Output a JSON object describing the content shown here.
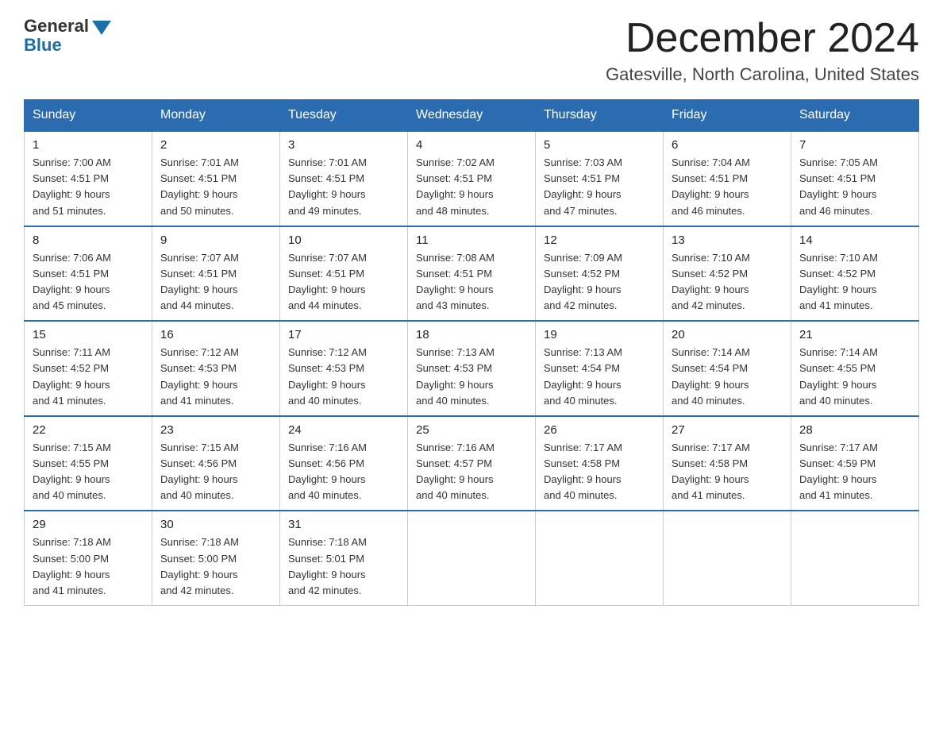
{
  "header": {
    "logo_general": "General",
    "logo_blue": "Blue",
    "month_title": "December 2024",
    "location": "Gatesville, North Carolina, United States"
  },
  "days_of_week": [
    "Sunday",
    "Monday",
    "Tuesday",
    "Wednesday",
    "Thursday",
    "Friday",
    "Saturday"
  ],
  "weeks": [
    [
      {
        "day": "1",
        "sunrise": "7:00 AM",
        "sunset": "4:51 PM",
        "daylight": "9 hours and 51 minutes."
      },
      {
        "day": "2",
        "sunrise": "7:01 AM",
        "sunset": "4:51 PM",
        "daylight": "9 hours and 50 minutes."
      },
      {
        "day": "3",
        "sunrise": "7:01 AM",
        "sunset": "4:51 PM",
        "daylight": "9 hours and 49 minutes."
      },
      {
        "day": "4",
        "sunrise": "7:02 AM",
        "sunset": "4:51 PM",
        "daylight": "9 hours and 48 minutes."
      },
      {
        "day": "5",
        "sunrise": "7:03 AM",
        "sunset": "4:51 PM",
        "daylight": "9 hours and 47 minutes."
      },
      {
        "day": "6",
        "sunrise": "7:04 AM",
        "sunset": "4:51 PM",
        "daylight": "9 hours and 46 minutes."
      },
      {
        "day": "7",
        "sunrise": "7:05 AM",
        "sunset": "4:51 PM",
        "daylight": "9 hours and 46 minutes."
      }
    ],
    [
      {
        "day": "8",
        "sunrise": "7:06 AM",
        "sunset": "4:51 PM",
        "daylight": "9 hours and 45 minutes."
      },
      {
        "day": "9",
        "sunrise": "7:07 AM",
        "sunset": "4:51 PM",
        "daylight": "9 hours and 44 minutes."
      },
      {
        "day": "10",
        "sunrise": "7:07 AM",
        "sunset": "4:51 PM",
        "daylight": "9 hours and 44 minutes."
      },
      {
        "day": "11",
        "sunrise": "7:08 AM",
        "sunset": "4:51 PM",
        "daylight": "9 hours and 43 minutes."
      },
      {
        "day": "12",
        "sunrise": "7:09 AM",
        "sunset": "4:52 PM",
        "daylight": "9 hours and 42 minutes."
      },
      {
        "day": "13",
        "sunrise": "7:10 AM",
        "sunset": "4:52 PM",
        "daylight": "9 hours and 42 minutes."
      },
      {
        "day": "14",
        "sunrise": "7:10 AM",
        "sunset": "4:52 PM",
        "daylight": "9 hours and 41 minutes."
      }
    ],
    [
      {
        "day": "15",
        "sunrise": "7:11 AM",
        "sunset": "4:52 PM",
        "daylight": "9 hours and 41 minutes."
      },
      {
        "day": "16",
        "sunrise": "7:12 AM",
        "sunset": "4:53 PM",
        "daylight": "9 hours and 41 minutes."
      },
      {
        "day": "17",
        "sunrise": "7:12 AM",
        "sunset": "4:53 PM",
        "daylight": "9 hours and 40 minutes."
      },
      {
        "day": "18",
        "sunrise": "7:13 AM",
        "sunset": "4:53 PM",
        "daylight": "9 hours and 40 minutes."
      },
      {
        "day": "19",
        "sunrise": "7:13 AM",
        "sunset": "4:54 PM",
        "daylight": "9 hours and 40 minutes."
      },
      {
        "day": "20",
        "sunrise": "7:14 AM",
        "sunset": "4:54 PM",
        "daylight": "9 hours and 40 minutes."
      },
      {
        "day": "21",
        "sunrise": "7:14 AM",
        "sunset": "4:55 PM",
        "daylight": "9 hours and 40 minutes."
      }
    ],
    [
      {
        "day": "22",
        "sunrise": "7:15 AM",
        "sunset": "4:55 PM",
        "daylight": "9 hours and 40 minutes."
      },
      {
        "day": "23",
        "sunrise": "7:15 AM",
        "sunset": "4:56 PM",
        "daylight": "9 hours and 40 minutes."
      },
      {
        "day": "24",
        "sunrise": "7:16 AM",
        "sunset": "4:56 PM",
        "daylight": "9 hours and 40 minutes."
      },
      {
        "day": "25",
        "sunrise": "7:16 AM",
        "sunset": "4:57 PM",
        "daylight": "9 hours and 40 minutes."
      },
      {
        "day": "26",
        "sunrise": "7:17 AM",
        "sunset": "4:58 PM",
        "daylight": "9 hours and 40 minutes."
      },
      {
        "day": "27",
        "sunrise": "7:17 AM",
        "sunset": "4:58 PM",
        "daylight": "9 hours and 41 minutes."
      },
      {
        "day": "28",
        "sunrise": "7:17 AM",
        "sunset": "4:59 PM",
        "daylight": "9 hours and 41 minutes."
      }
    ],
    [
      {
        "day": "29",
        "sunrise": "7:18 AM",
        "sunset": "5:00 PM",
        "daylight": "9 hours and 41 minutes."
      },
      {
        "day": "30",
        "sunrise": "7:18 AM",
        "sunset": "5:00 PM",
        "daylight": "9 hours and 42 minutes."
      },
      {
        "day": "31",
        "sunrise": "7:18 AM",
        "sunset": "5:01 PM",
        "daylight": "9 hours and 42 minutes."
      },
      null,
      null,
      null,
      null
    ]
  ],
  "labels": {
    "sunrise": "Sunrise:",
    "sunset": "Sunset:",
    "daylight": "Daylight:"
  }
}
